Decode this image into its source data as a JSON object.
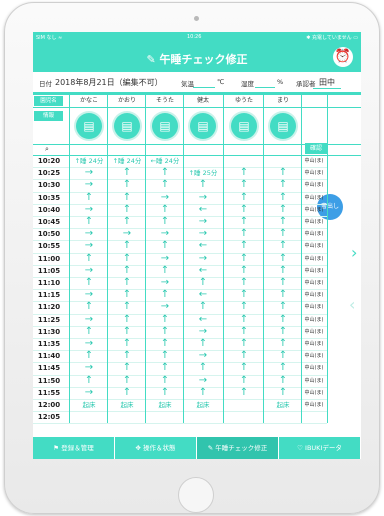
{
  "status_bar": {
    "carrier": "SIM なし ≈",
    "time": "10:26",
    "battery": "✱ 充電していません ▭"
  },
  "header": {
    "title": "午睡チェック修正",
    "title_icon": "pencil-icon",
    "clock_icon": "alarm-clock-icon"
  },
  "info": {
    "date_label": "日付",
    "date_value": "2018年8月21日（編集不可）",
    "temp_label": "気温",
    "temp_unit": "℃",
    "humidity_label": "湿度",
    "humidity_unit": "%",
    "checker_label": "承認者",
    "checker_value": "田中"
  },
  "grid": {
    "name_header": "園児名",
    "report_header": "情報",
    "children": [
      "かなこ",
      "かおり",
      "そうた",
      "健太",
      "ゆうた",
      "まり"
    ],
    "confirm_header": "確認",
    "output_button": "書出し",
    "times": [
      "10:20",
      "10:25",
      "10:30",
      "10:35",
      "10:40",
      "10:45",
      "10:50",
      "10:55",
      "11:00",
      "11:05",
      "11:10",
      "11:15",
      "11:20",
      "11:25",
      "11:30",
      "11:35",
      "11:40",
      "11:45",
      "11:50",
      "11:55",
      "12:00",
      "12:05"
    ],
    "first_row": [
      "↑睡 24分",
      "↑睡 24分",
      "←睡 24分",
      "",
      "",
      ""
    ],
    "second_row": [
      "→",
      "↑",
      "↑",
      "↑睡 25分",
      "↑",
      "↑"
    ],
    "patterns": [
      [
        "→",
        "↑",
        "↑",
        "↑",
        "↑",
        "↑"
      ],
      [
        "↑",
        "↑",
        "→",
        "→",
        "↑",
        "↑"
      ],
      [
        "→",
        "↑",
        "↑",
        "←",
        "↑",
        "↑"
      ],
      [
        "↑",
        "↑",
        "↑",
        "→",
        "↑",
        "↑"
      ],
      [
        "→",
        "→",
        "→",
        "→",
        "↑",
        "↑"
      ],
      [
        "→",
        "↑",
        "↑",
        "←",
        "↑",
        "↑"
      ],
      [
        "↑",
        "↑",
        "→",
        "→",
        "↑",
        "↑"
      ],
      [
        "→",
        "↑",
        "↑",
        "←",
        "↑",
        "↑"
      ],
      [
        "↑",
        "↑",
        "→",
        "↑",
        "↑",
        "↑"
      ],
      [
        "→",
        "↑",
        "↑",
        "←",
        "↑",
        "↑"
      ],
      [
        "↑",
        "↑",
        "→",
        "↑",
        "↑",
        "↑"
      ],
      [
        "→",
        "↑",
        "↑",
        "←",
        "↑",
        "↑"
      ],
      [
        "↑",
        "↑",
        "↑",
        "→",
        "↑",
        "↑"
      ],
      [
        "→",
        "↑",
        "↑",
        "↑",
        "↑",
        "↑"
      ],
      [
        "↑",
        "↑",
        "↑",
        "→",
        "↑",
        "↑"
      ],
      [
        "→",
        "↑",
        "↑",
        "↑",
        "↑",
        "↑"
      ],
      [
        "↑",
        "↑",
        "↑",
        "→",
        "↑",
        "↑"
      ],
      [
        "→",
        "↑",
        "↑",
        "↑",
        "↑",
        "↑"
      ],
      [
        "↑",
        "↑",
        "↑",
        "→",
        "↑",
        "↑"
      ]
    ],
    "last_row": [
      "起床",
      "起床",
      "起床",
      "起床",
      "",
      "起床"
    ],
    "confirm_value": "中山(ま)"
  },
  "tabs": [
    {
      "label": "登録＆管理",
      "icon": "flag-icon"
    },
    {
      "label": "操作＆状態",
      "icon": "move-icon"
    },
    {
      "label": "午睡チェック修正",
      "icon": "pencil-icon"
    },
    {
      "label": "IBUKIデータ",
      "icon": "heart-icon"
    }
  ],
  "accent_color": "#43dcc4"
}
